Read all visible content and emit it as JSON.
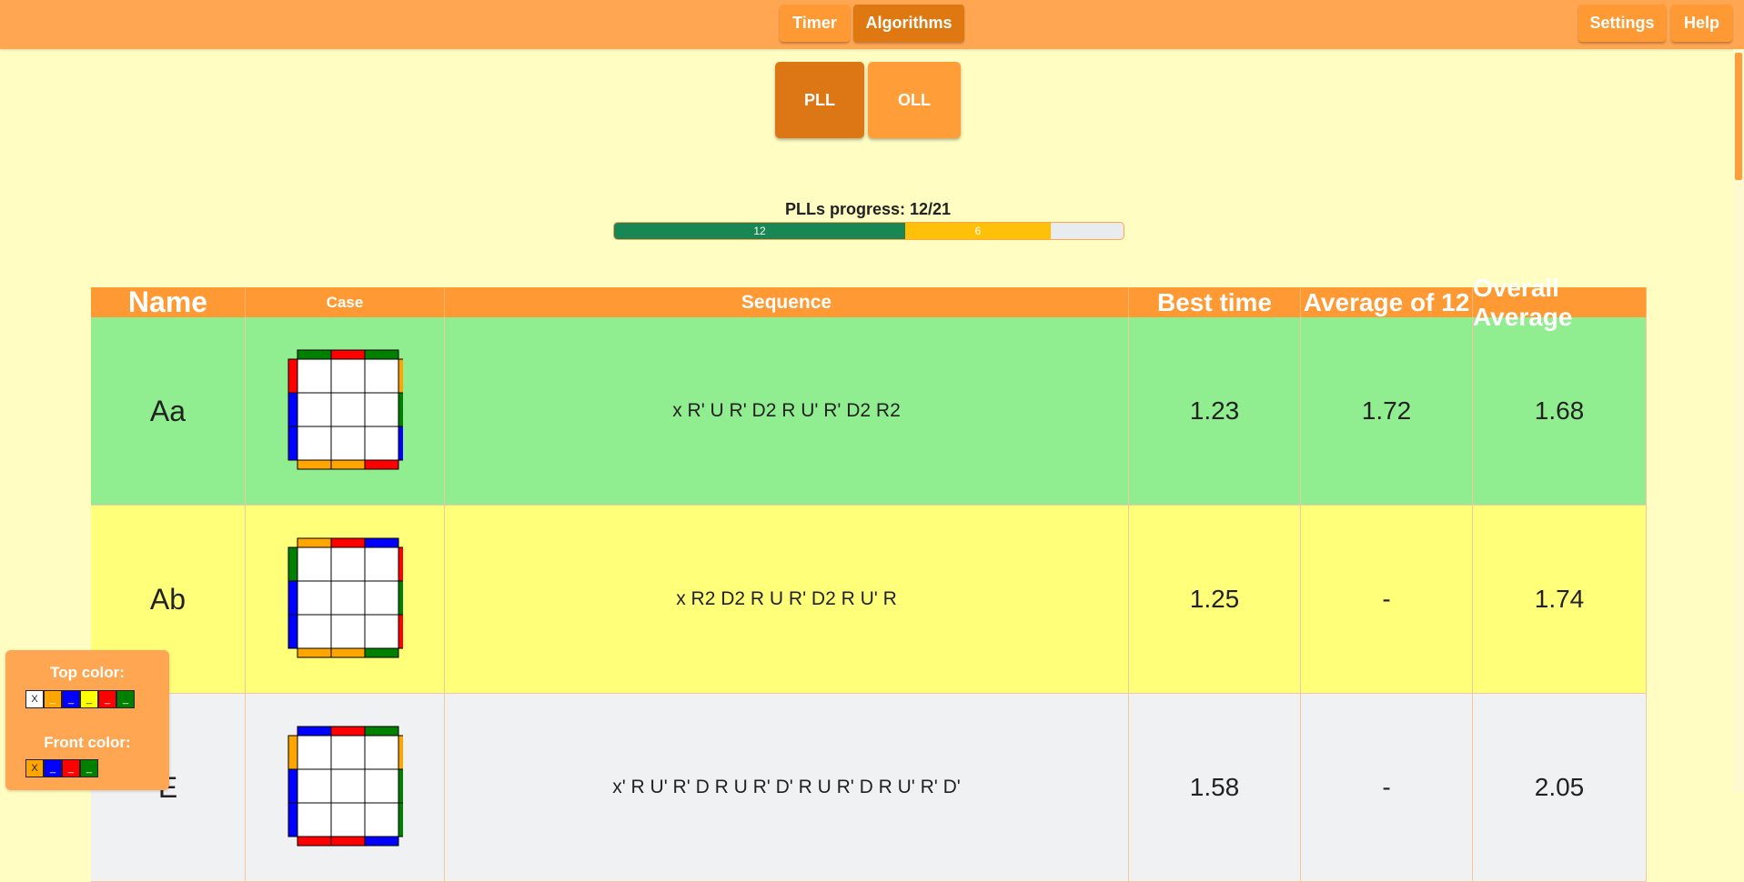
{
  "nav": {
    "timer": "Timer",
    "algorithms": "Algorithms",
    "settings": "Settings",
    "help": "Help"
  },
  "modes": {
    "pll": "PLL",
    "oll": "OLL"
  },
  "progress": {
    "title": "PLLs progress: 12/21",
    "learned": 12,
    "learning": 6,
    "total": 21,
    "learned_label": "12",
    "learning_label": "6"
  },
  "table": {
    "headers": [
      "Name",
      "Case",
      "Sequence",
      "Best time",
      "Average of 12",
      "Overall Average"
    ],
    "rows": [
      {
        "name": "Aa",
        "sequence": "x R' U R' D2 R U' R' D2 R2",
        "best": "1.23",
        "avg12": "1.72",
        "overall": "1.68",
        "status": "learned"
      },
      {
        "name": "Ab",
        "sequence": "x R2 D2 R U R' D2 R U' R",
        "best": "1.25",
        "avg12": "-",
        "overall": "1.74",
        "status": "learning"
      },
      {
        "name": "E",
        "sequence": "x' R U' R' D R U R' D' R U R' D R U' R' D'",
        "best": "1.58",
        "avg12": "-",
        "overall": "2.05",
        "status": "not-learned"
      }
    ]
  },
  "color_settings": {
    "top_label": "Top color:",
    "front_label": "Front color:",
    "top_colors": [
      {
        "color": "#FFFFFF",
        "mark": "X"
      },
      {
        "color": "#FFA500",
        "mark": "_"
      },
      {
        "color": "#0000FF",
        "mark": "_"
      },
      {
        "color": "#FFFF00",
        "mark": "_"
      },
      {
        "color": "#FF0000",
        "mark": "_"
      },
      {
        "color": "#008000",
        "mark": "_"
      }
    ],
    "front_colors": [
      {
        "color": "#FFA500",
        "mark": "X"
      },
      {
        "color": "#0000FF",
        "mark": "_"
      },
      {
        "color": "#FF0000",
        "mark": "_"
      },
      {
        "color": "#008000",
        "mark": "_"
      }
    ]
  },
  "colors": {
    "header": "#FFA652",
    "accent": "#FF9933",
    "active": "#E07812",
    "learned_row": "#91EE90",
    "learning_row": "#FFFF7A",
    "unlearned_row": "#F0F1F2"
  },
  "cases": {
    "Aa": {
      "top": [
        "#008000",
        "#FF0000",
        "#008000"
      ],
      "left": [
        "#FF0000",
        "#0000FF",
        "#0000FF"
      ],
      "right": [
        "#FFA500",
        "#008000",
        "#0000FF"
      ],
      "bottom": [
        "#FFA500",
        "#FFA500",
        "#FF0000"
      ]
    },
    "Ab": {
      "top": [
        "#FFA500",
        "#FF0000",
        "#0000FF"
      ],
      "left": [
        "#008000",
        "#0000FF",
        "#0000FF"
      ],
      "right": [
        "#FF0000",
        "#008000",
        "#FF0000"
      ],
      "bottom": [
        "#FFA500",
        "#FFA500",
        "#008000"
      ]
    },
    "E": {
      "top": [
        "#0000FF",
        "#FF0000",
        "#008000"
      ],
      "left": [
        "#FFA500",
        "#0000FF",
        "#0000FF"
      ],
      "right": [
        "#FFA500",
        "#008000",
        "#008000"
      ],
      "bottom": [
        "#FF0000",
        "#FF0000",
        "#0000FF"
      ]
    }
  }
}
